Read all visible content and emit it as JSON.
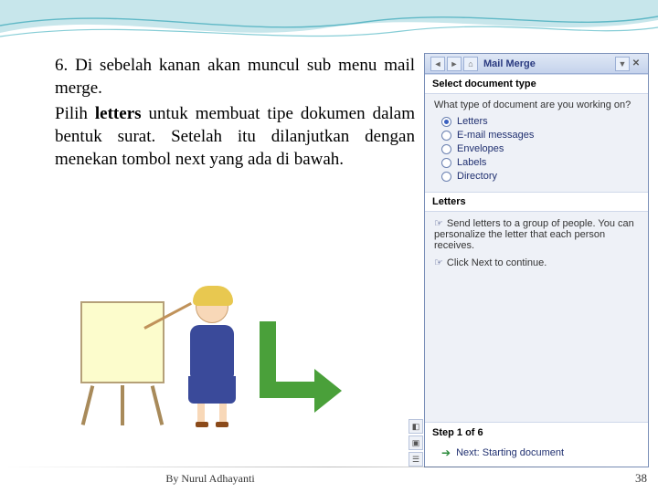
{
  "text": {
    "num": "6.",
    "p1": "Di sebelah kanan akan muncul sub menu mail merge.",
    "p2a": "Pilih ",
    "p2bold": "letters",
    "p2b": " untuk membuat tipe dokumen dalam bentuk surat. Setelah itu dilanjutkan dengan menekan tombol next yang ada di bawah."
  },
  "footer": {
    "author": "By Nurul Adhayanti",
    "page": "38"
  },
  "taskpane": {
    "title": "Mail Merge",
    "section_select": "Select document type",
    "question": "What type of document are you working on?",
    "options": [
      "Letters",
      "E-mail messages",
      "Envelopes",
      "Labels",
      "Directory"
    ],
    "selected_index": 0,
    "section_letters": "Letters",
    "desc1": "Send letters to a group of people. You can personalize the letter that each person receives.",
    "desc2": "Click Next to continue.",
    "step_label": "Step 1 of 6",
    "next_label": "Next: Starting document"
  }
}
